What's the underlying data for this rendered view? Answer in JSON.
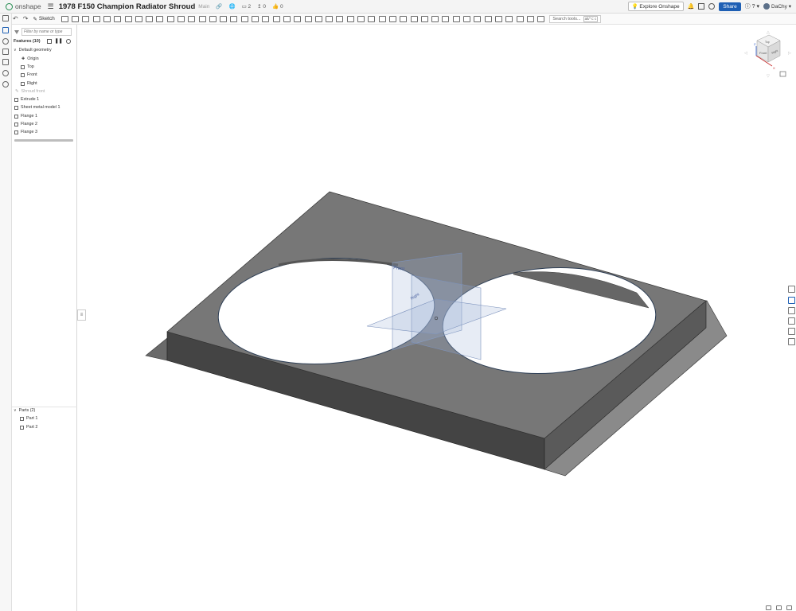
{
  "app": {
    "logo_text": "onshape",
    "doc_title": "1978 F150 Champion Radiator Shroud",
    "branch": "Main",
    "versions_count": "2",
    "branches_count": "0",
    "likes_count": "0"
  },
  "topbar": {
    "explore_label": "Explore Onshape",
    "share_label": "Share",
    "help_label": "?",
    "user_name": "DaChy"
  },
  "toolbar": {
    "sketch_label": "Sketch",
    "search_placeholder": "Search tools...",
    "search_shortcut": "alt/⌥ c"
  },
  "feature_panel": {
    "filter_placeholder": "Filter by name or type",
    "features_header": "Features (10)",
    "default_geometry": "Default geometry",
    "origin": "Origin",
    "planes": [
      "Top",
      "Front",
      "Right"
    ],
    "features": [
      "Shroud front",
      "Extrude 1",
      "Sheet metal model 1",
      "Flange 1",
      "Flange 2",
      "Flange 3"
    ],
    "parts_header": "Parts (2)",
    "parts": [
      "Part 1",
      "Part 2"
    ]
  },
  "viewcube": {
    "top_label": "Top",
    "front_label": "Front",
    "right_label": "Right",
    "axis_x": "X",
    "axis_z": "Z"
  },
  "viewport": {
    "plane_front_label": "Front",
    "plane_right_label": "Right"
  },
  "colors": {
    "brand": "#1f8a4c",
    "share": "#1e5fb4",
    "top_face": "#767676",
    "front_face": "#444444",
    "side_face": "#5a5a5a",
    "plane": "#9fb4d9"
  }
}
